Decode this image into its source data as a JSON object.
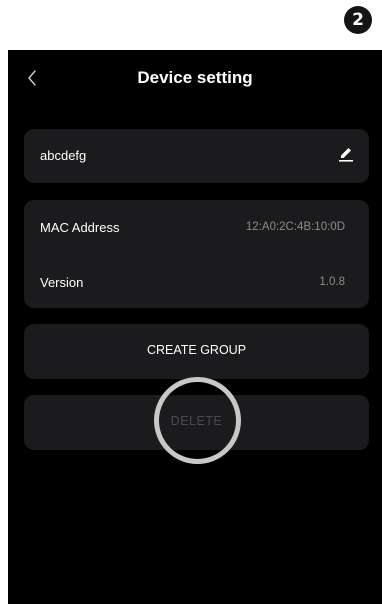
{
  "step_badge": "2",
  "header": {
    "title": "Device setting",
    "back_icon": "chevron-left-icon"
  },
  "device": {
    "name": "abcdefg",
    "edit_icon": "pencil-icon"
  },
  "info": {
    "mac_label": "MAC Address",
    "mac_value": "12:A0:2C:4B:10:0D",
    "version_label": "Version",
    "version_value": "1.0.8"
  },
  "actions": {
    "create_group_label": "CREATE GROUP",
    "delete_label": "DELETE"
  },
  "colors": {
    "screen_background": "#000000",
    "card_background": "#1b1b1d",
    "primary_text": "#ffffff",
    "secondary_text": "#8c8c8c",
    "disabled_text": "#4a4a4c",
    "tap_ring": "#c8c8c8"
  }
}
